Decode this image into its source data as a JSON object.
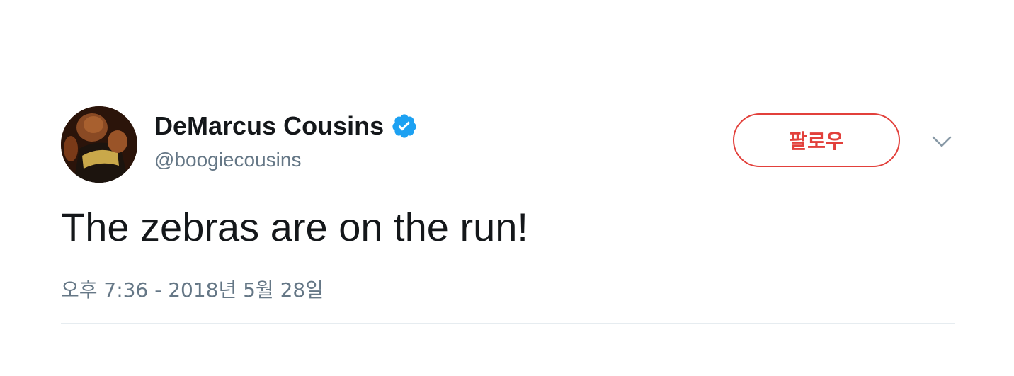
{
  "tweet": {
    "author": {
      "display_name": "DeMarcus Cousins",
      "handle": "@boogiecousins",
      "verified": true,
      "avatar_icon": "profile-photo"
    },
    "follow_label": "팔로우",
    "menu_icon": "chevron-down-icon",
    "text": "The zebras are on the run!",
    "timestamp": "오후 7:36 - 2018년 5월 28일"
  },
  "colors": {
    "accent": "#e2403b",
    "verified": "#1da1f2",
    "muted_text": "#657786",
    "text": "#14171a",
    "divider": "#e6ecf0"
  }
}
